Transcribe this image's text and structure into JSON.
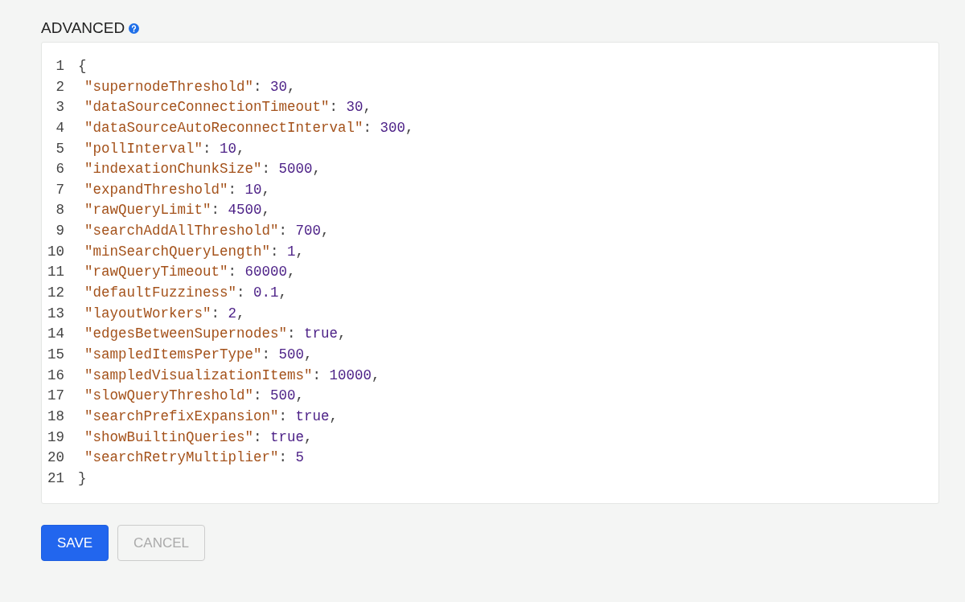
{
  "section": {
    "title": "ADVANCED"
  },
  "editor": {
    "lines": [
      {
        "kind": "brace",
        "number": "1",
        "text": "{"
      },
      {
        "kind": "entry",
        "number": "2",
        "key": "\"supernodeThreshold\"",
        "sep": ": ",
        "value": "30",
        "trail": ","
      },
      {
        "kind": "entry",
        "number": "3",
        "key": "\"dataSourceConnectionTimeout\"",
        "sep": ": ",
        "value": "30",
        "trail": ","
      },
      {
        "kind": "entry",
        "number": "4",
        "key": "\"dataSourceAutoReconnectInterval\"",
        "sep": ": ",
        "value": "300",
        "trail": ","
      },
      {
        "kind": "entry",
        "number": "5",
        "key": "\"pollInterval\"",
        "sep": ": ",
        "value": "10",
        "trail": ","
      },
      {
        "kind": "entry",
        "number": "6",
        "key": "\"indexationChunkSize\"",
        "sep": ": ",
        "value": "5000",
        "trail": ","
      },
      {
        "kind": "entry",
        "number": "7",
        "key": "\"expandThreshold\"",
        "sep": ": ",
        "value": "10",
        "trail": ","
      },
      {
        "kind": "entry",
        "number": "8",
        "key": "\"rawQueryLimit\"",
        "sep": ": ",
        "value": "4500",
        "trail": ","
      },
      {
        "kind": "entry",
        "number": "9",
        "key": "\"searchAddAllThreshold\"",
        "sep": ": ",
        "value": "700",
        "trail": ","
      },
      {
        "kind": "entry",
        "number": "10",
        "key": "\"minSearchQueryLength\"",
        "sep": ": ",
        "value": "1",
        "trail": ","
      },
      {
        "kind": "entry",
        "number": "11",
        "key": "\"rawQueryTimeout\"",
        "sep": ": ",
        "value": "60000",
        "trail": ","
      },
      {
        "kind": "entry",
        "number": "12",
        "key": "\"defaultFuzziness\"",
        "sep": ": ",
        "value": "0.1",
        "trail": ","
      },
      {
        "kind": "entry",
        "number": "13",
        "key": "\"layoutWorkers\"",
        "sep": ": ",
        "value": "2",
        "trail": ","
      },
      {
        "kind": "entry",
        "number": "14",
        "key": "\"edgesBetweenSupernodes\"",
        "sep": ": ",
        "value": "true",
        "trail": ","
      },
      {
        "kind": "entry",
        "number": "15",
        "key": "\"sampledItemsPerType\"",
        "sep": ": ",
        "value": "500",
        "trail": ","
      },
      {
        "kind": "entry",
        "number": "16",
        "key": "\"sampledVisualizationItems\"",
        "sep": ": ",
        "value": "10000",
        "trail": ","
      },
      {
        "kind": "entry",
        "number": "17",
        "key": "\"slowQueryThreshold\"",
        "sep": ": ",
        "value": "500",
        "trail": ","
      },
      {
        "kind": "entry",
        "number": "18",
        "key": "\"searchPrefixExpansion\"",
        "sep": ": ",
        "value": "true",
        "trail": ","
      },
      {
        "kind": "entry",
        "number": "19",
        "key": "\"showBuiltinQueries\"",
        "sep": ": ",
        "value": "true",
        "trail": ","
      },
      {
        "kind": "entry",
        "number": "20",
        "key": "\"searchRetryMultiplier\"",
        "sep": ": ",
        "value": "5"
      },
      {
        "kind": "brace",
        "number": "21",
        "text": "}"
      }
    ]
  },
  "buttons": [
    {
      "label": "SAVE",
      "kind": "primary",
      "disabled": false
    },
    {
      "label": "CANCEL",
      "kind": "secondary",
      "disabled": true
    }
  ]
}
